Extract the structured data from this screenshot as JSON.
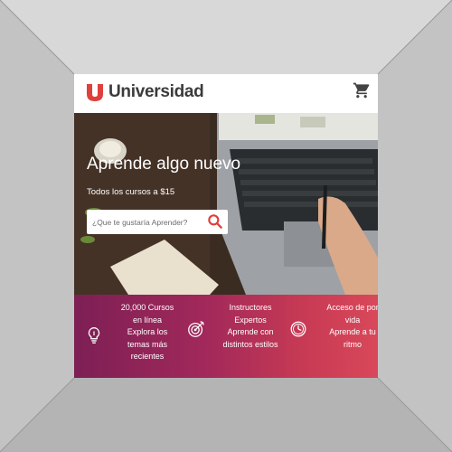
{
  "brand": {
    "name": "Universidad",
    "accent": "#e0403c"
  },
  "header": {
    "cart_icon": "shopping-cart-icon"
  },
  "hero": {
    "title": "Aprende algo nuevo",
    "subtitle": "Todos los cursos a $15",
    "search_placeholder": "¿Que te gustaría Aprender?",
    "search_icon": "search-icon"
  },
  "features": [
    {
      "icon": "lightbulb-icon",
      "line1": "20,000 Cursos",
      "line2": "en línea",
      "line3": "Explora los",
      "line4": "temas más",
      "line5": "recientes"
    },
    {
      "icon": "target-icon",
      "line1": "Instructores",
      "line2": "Expertos",
      "line3": "Aprende con",
      "line4": "distintos estilos"
    },
    {
      "icon": "clock-icon",
      "line1": "Acceso de por",
      "line2": "vida",
      "line3": "Aprende a tu",
      "line4": "ritmo"
    }
  ],
  "colors": {
    "gradient_start": "#7d1f55",
    "gradient_end": "#d9485a",
    "frame": "#c9c9c9"
  }
}
